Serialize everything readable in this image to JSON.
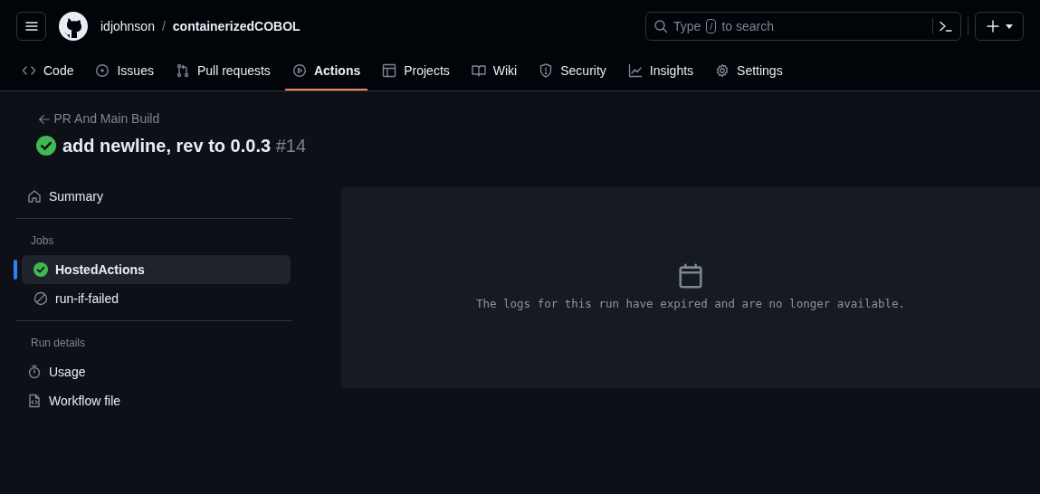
{
  "header": {
    "owner": "idjohnson",
    "separator": "/",
    "repo": "containerizedCOBOL",
    "search": {
      "placeholder_before": "Type",
      "key": "/",
      "placeholder_after": "to search"
    }
  },
  "tabs": [
    {
      "label": "Code",
      "selected": false
    },
    {
      "label": "Issues",
      "selected": false
    },
    {
      "label": "Pull requests",
      "selected": false
    },
    {
      "label": "Actions",
      "selected": true
    },
    {
      "label": "Projects",
      "selected": false
    },
    {
      "label": "Wiki",
      "selected": false
    },
    {
      "label": "Security",
      "selected": false
    },
    {
      "label": "Insights",
      "selected": false
    },
    {
      "label": "Settings",
      "selected": false
    }
  ],
  "run": {
    "back_link": "PR And Main Build",
    "title": "add newline, rev to 0.0.3",
    "number": "#14",
    "kind": "success"
  },
  "sidebar": {
    "summary": "Summary",
    "jobs_heading": "Jobs",
    "jobs": [
      {
        "label": "HostedActions",
        "kind": "success",
        "selected": true
      },
      {
        "label": "run-if-failed",
        "kind": "skipped",
        "selected": false
      }
    ],
    "details_heading": "Run details",
    "details": [
      "Usage",
      "Workflow file"
    ]
  },
  "log_panel": {
    "message": "The logs for this run have expired and are no longer available."
  }
}
